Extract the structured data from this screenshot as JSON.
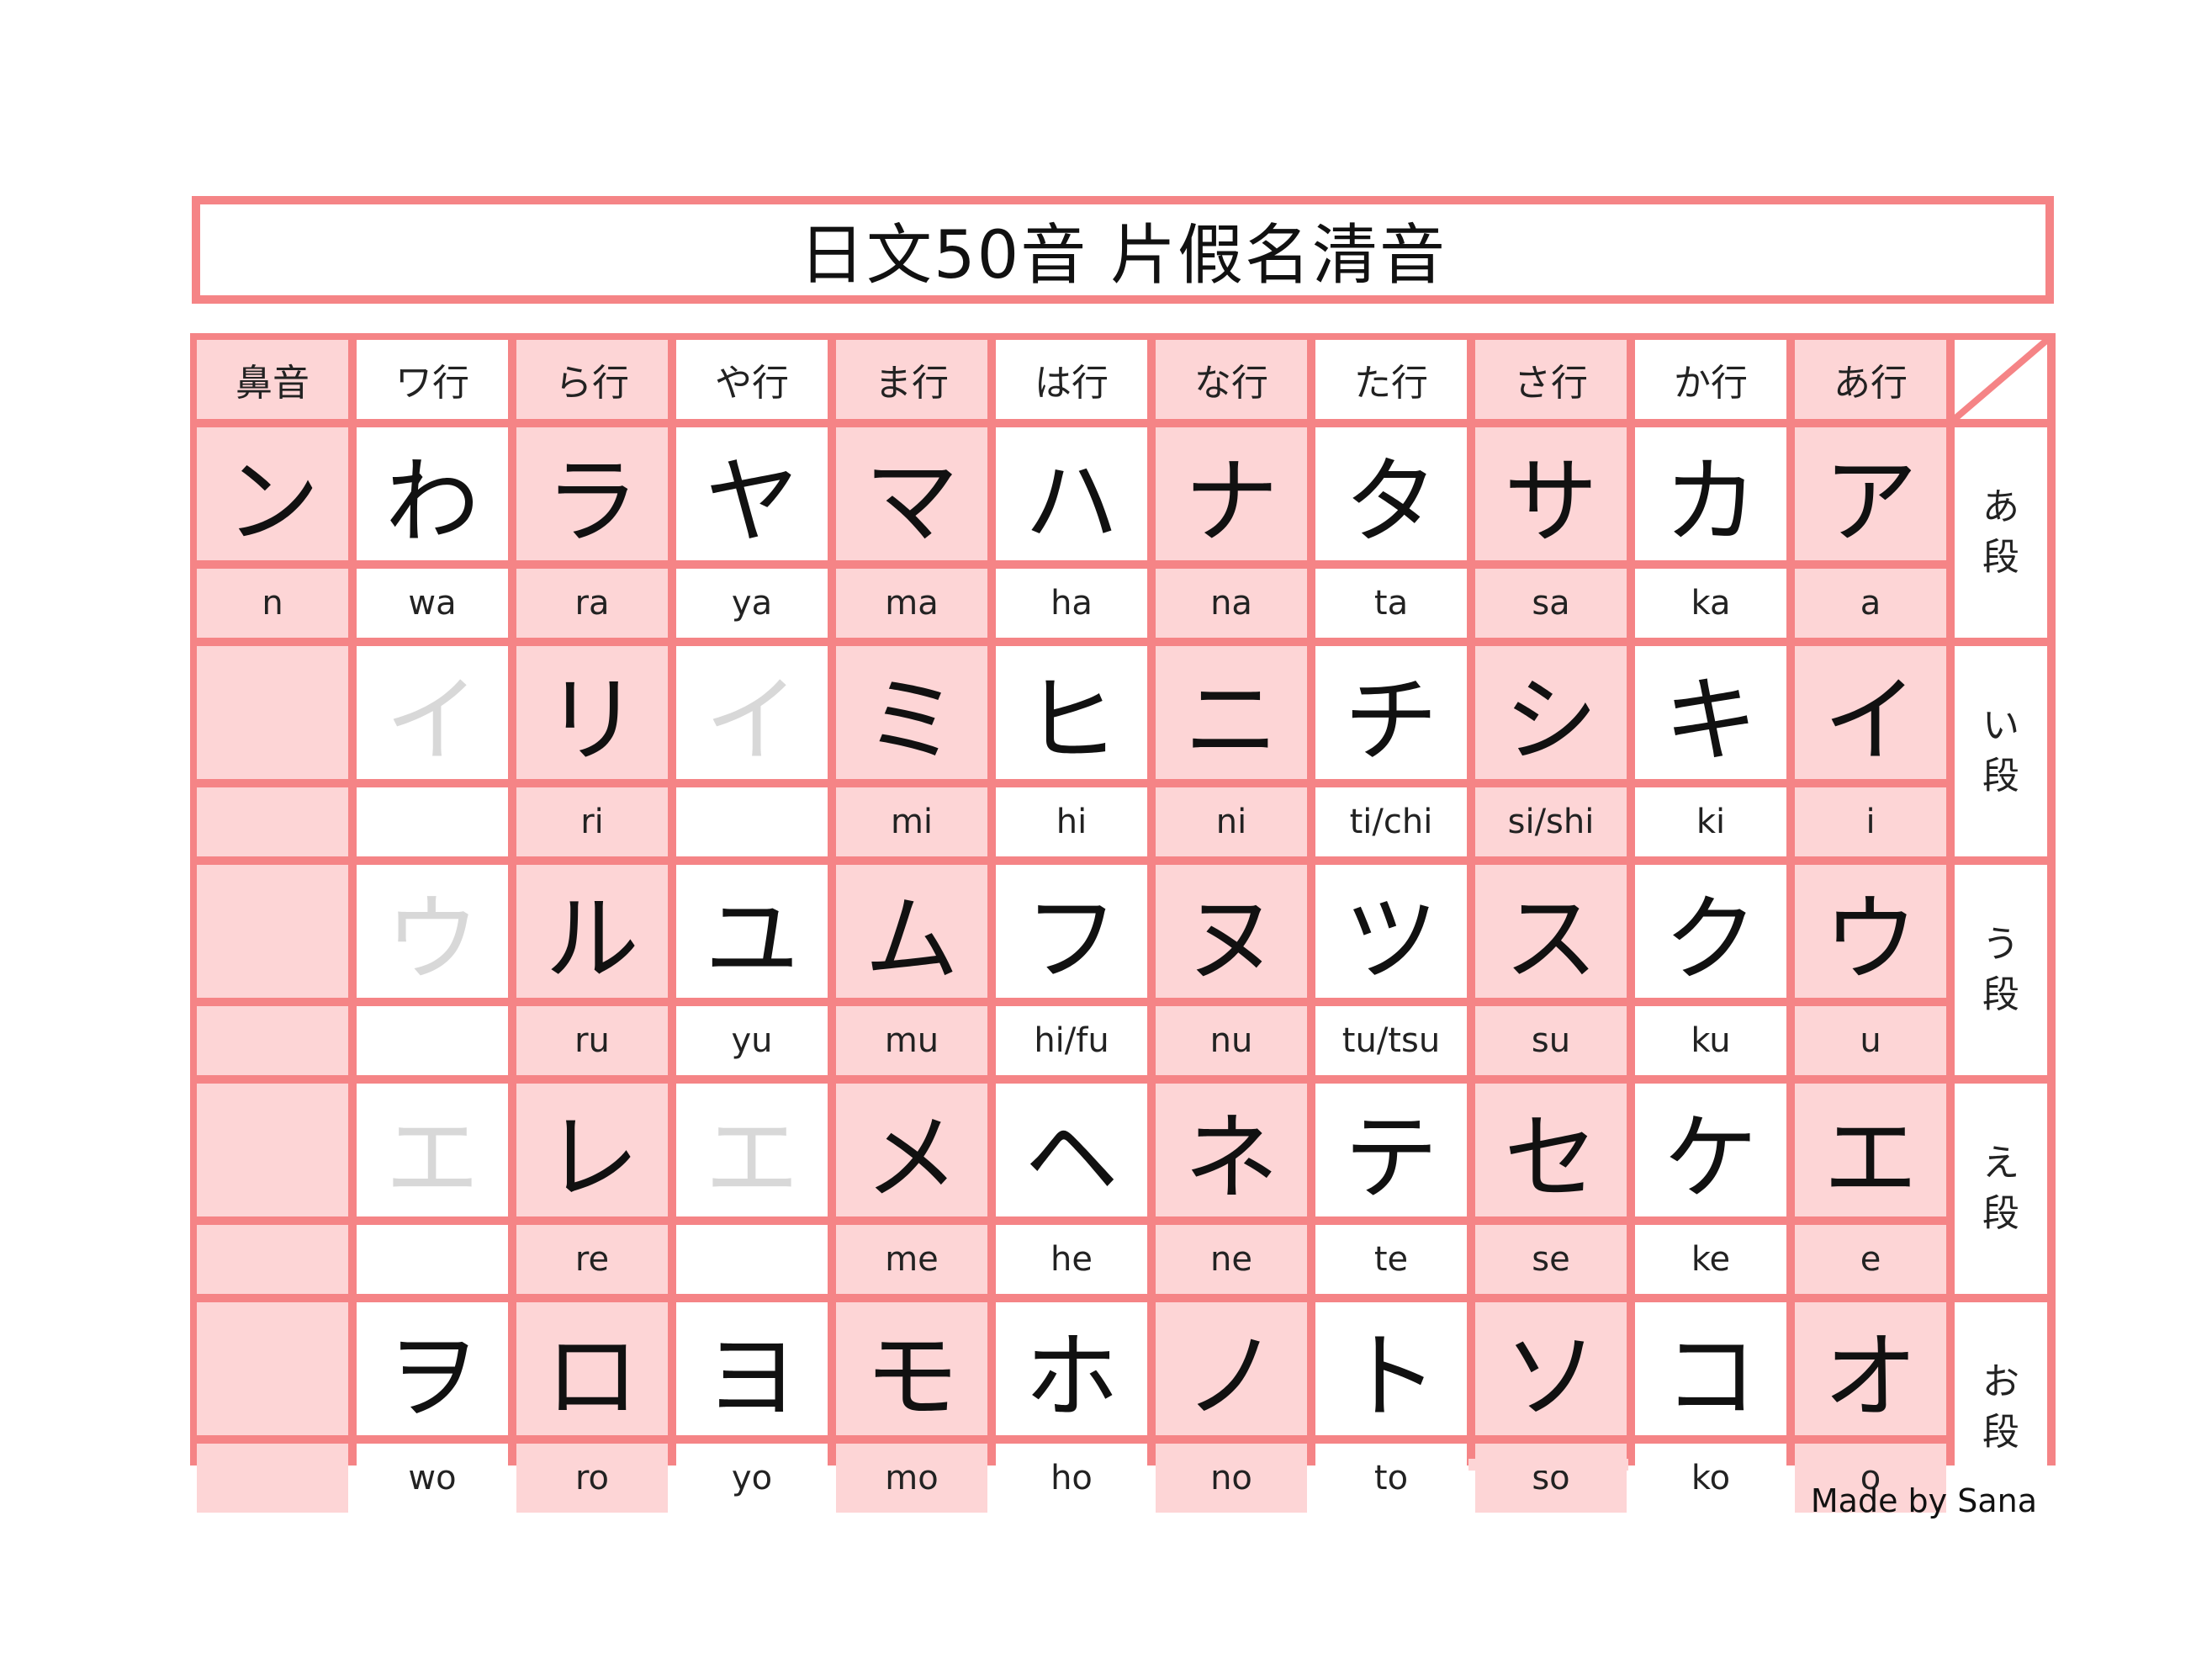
{
  "title": "日文50音 片假名清音",
  "credit": "Made by Sana",
  "colors": {
    "border": "#f58486",
    "pink_cell": "#fdd5d6",
    "white_cell": "#ffffff",
    "faded_kana": "#d8d8d8"
  },
  "headers": [
    "鼻音",
    "ワ行",
    "ら行",
    "や行",
    "ま行",
    "は行",
    "な行",
    "た行",
    "さ行",
    "か行",
    "あ行"
  ],
  "dan_labels": [
    "あ段",
    "い段",
    "う段",
    "え段",
    "お段"
  ],
  "rows": [
    {
      "kana": [
        "ン",
        "わ",
        "ラ",
        "ヤ",
        "マ",
        "ハ",
        "ナ",
        "タ",
        "サ",
        "カ",
        "ア"
      ],
      "romaji": [
        "n",
        "wa",
        "ra",
        "ya",
        "ma",
        "ha",
        "na",
        "ta",
        "sa",
        "ka",
        "a"
      ],
      "faded": [
        false,
        false,
        false,
        false,
        false,
        false,
        false,
        false,
        false,
        false,
        false
      ]
    },
    {
      "kana": [
        "",
        "イ",
        "リ",
        "イ",
        "ミ",
        "ヒ",
        "ニ",
        "チ",
        "シ",
        "キ",
        "イ"
      ],
      "romaji": [
        "",
        "",
        "ri",
        "",
        "mi",
        "hi",
        "ni",
        "ti/chi",
        "si/shi",
        "ki",
        "i"
      ],
      "faded": [
        false,
        true,
        false,
        true,
        false,
        false,
        false,
        false,
        false,
        false,
        false
      ]
    },
    {
      "kana": [
        "",
        "ウ",
        "ル",
        "ユ",
        "ム",
        "フ",
        "ヌ",
        "ツ",
        "ス",
        "ク",
        "ウ"
      ],
      "romaji": [
        "",
        "",
        "ru",
        "yu",
        "mu",
        "hi/fu",
        "nu",
        "tu/tsu",
        "su",
        "ku",
        "u"
      ],
      "faded": [
        false,
        true,
        false,
        false,
        false,
        false,
        false,
        false,
        false,
        false,
        false
      ]
    },
    {
      "kana": [
        "",
        "エ",
        "レ",
        "エ",
        "メ",
        "ヘ",
        "ネ",
        "テ",
        "セ",
        "ケ",
        "エ"
      ],
      "romaji": [
        "",
        "",
        "re",
        "",
        "me",
        "he",
        "ne",
        "te",
        "se",
        "ke",
        "e"
      ],
      "faded": [
        false,
        true,
        false,
        true,
        false,
        false,
        false,
        false,
        false,
        false,
        false
      ]
    },
    {
      "kana": [
        "",
        "ヲ",
        "ロ",
        "ヨ",
        "モ",
        "ホ",
        "ノ",
        "ト",
        "ソ",
        "コ",
        "オ"
      ],
      "romaji": [
        "",
        "wo",
        "ro",
        "yo",
        "mo",
        "ho",
        "no",
        "to",
        "so",
        "ko",
        "o"
      ],
      "faded": [
        false,
        false,
        false,
        false,
        false,
        false,
        false,
        false,
        false,
        false,
        false
      ]
    }
  ]
}
